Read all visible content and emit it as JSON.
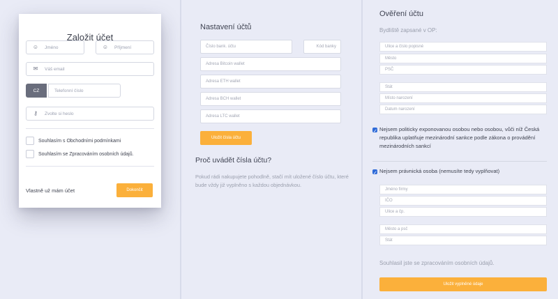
{
  "register": {
    "title": "Založit účet",
    "first_name_placeholder": "Jméno",
    "last_name_placeholder": "Příjmení",
    "email_placeholder": "Váš email",
    "phone_prefix": "CZ",
    "phone_placeholder": "Telefonní číslo",
    "password_placeholder": "Zvolte si heslo",
    "terms_label": "Souhlasím s Obchodními podmínkami",
    "privacy_label": "Souhlasím se Zpracováním osobních údajů.",
    "have_account": "Vlastně už mám účet",
    "finish_button": "Dokončit"
  },
  "account_settings": {
    "title": "Nastavení účtů",
    "bank_account_placeholder": "Číslo bank. účtu",
    "bank_code_placeholder": "Kód banky",
    "bitcoin_placeholder": "Adresa Bitcoin wallet",
    "eth_placeholder": "Adresa ETH wallet",
    "bch_placeholder": "Adresa BCH wallet",
    "ltc_placeholder": "Adresa LTC wallet",
    "save_button": "Uložit čísla účtu",
    "why_title": "Proč uvádět čísla účtu?",
    "why_text": "Pokud rádi nakupujete pohodlně, stačí mít uložené číslo účtu, které bude vždy již vyplněno s každou objednávkou."
  },
  "verification": {
    "title": "Ověření účtu",
    "residence_label": "Bydliště zapsané v OP:",
    "street_placeholder": "Ulice a číslo popisné",
    "city_placeholder": "Město",
    "zip_placeholder": "PSČ",
    "country_placeholder": "Stát",
    "birthplace_placeholder": "Místo narození",
    "birthdate_placeholder": "Datum narození",
    "pep_label": "Nejsem politicky exponovanou osobou nebo osobou, vůči níž Česká republika uplatňuje mezinárodní sankce podle zákona o provádění mezinárodních sankcí",
    "legal_entity_label": "Nejsem právnická osoba (nemusíte tedy vyplňovat)",
    "company_name_placeholder": "Jméno firmy",
    "ico_placeholder": "IČO",
    "company_street_placeholder": "Ulice a čp.",
    "company_city_zip_placeholder": "Město a psč",
    "company_country_placeholder": "Stát",
    "consent_text": "Souhlasil jste se zpracováním osobních údajů.",
    "save_button": "Uložit vyplněné údaje"
  },
  "colors": {
    "accent": "#fbb03b",
    "background": "#e9ebf6",
    "checkbox": "#2f6bd8"
  }
}
